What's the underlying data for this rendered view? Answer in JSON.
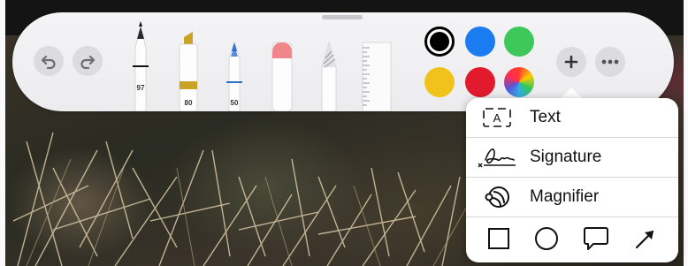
{
  "toolbar": {
    "tools": [
      {
        "name": "pen",
        "label": "97"
      },
      {
        "name": "marker",
        "label": "80"
      },
      {
        "name": "pencil",
        "label": "50"
      },
      {
        "name": "eraser",
        "label": ""
      },
      {
        "name": "lasso",
        "label": ""
      },
      {
        "name": "ruler",
        "label": ""
      }
    ],
    "colors": {
      "black": "#000000",
      "blue": "#1a7cf0",
      "green": "#3ec85a",
      "yellow": "#f1c21b",
      "red": "#e11a2c",
      "accent_marker": "#c9a226",
      "accent_pencil": "#2d6fcf"
    }
  },
  "menu": {
    "items": [
      {
        "icon": "text-box-icon",
        "label": "Text"
      },
      {
        "icon": "signature-icon",
        "label": "Signature"
      },
      {
        "icon": "magnifier-icon",
        "label": "Magnifier"
      }
    ],
    "shapes": [
      "square-icon",
      "circle-icon",
      "speech-bubble-icon",
      "arrow-icon"
    ]
  }
}
